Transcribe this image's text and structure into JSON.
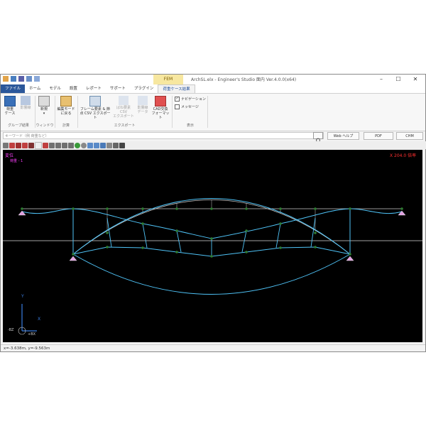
{
  "window": {
    "title": "ArchSL.elx - Engineer's Studio 面内 Ver.4.0.0(x64)",
    "context_tab_group": "FEM",
    "controls": {
      "minimize": "–",
      "maximize": "☐",
      "close": "✕"
    }
  },
  "menu": {
    "items": [
      "ファイル",
      "ホーム",
      "モデル",
      "設置",
      "レポート",
      "サポート",
      "プラグイン",
      "荷重ケース結果"
    ]
  },
  "ribbon": {
    "buttons": [
      {
        "label1": "荷重",
        "label2": "ケース"
      },
      {
        "label1": "影響線",
        "label2": ""
      },
      {
        "label1": "新規",
        "label2": "▾"
      },
      {
        "label1": "編集モード",
        "label2": "に戻る"
      },
      {
        "label1": "フレーム要素 & 節",
        "label2": "点 CSV エクスポート"
      },
      {
        "label1": "ばね要素 CSV",
        "label2": "エクスポート"
      },
      {
        "label1": "影響線",
        "label2": "データ"
      },
      {
        "label1": "CAD交換",
        "label2": "フォーマット"
      }
    ],
    "groups": [
      "グループ結果",
      "ウィンドウ",
      "計算",
      "エクスポート",
      "表示"
    ],
    "checkboxes": [
      {
        "label": "ナビゲーション",
        "checked": true
      },
      {
        "label": "メッセージ",
        "checked": false
      }
    ]
  },
  "search": {
    "placeholder": "キーワード（例 荷重など）",
    "buttons": [
      "Web ヘルプ",
      "PDF",
      "CHM"
    ]
  },
  "viewport": {
    "view_label": "変位",
    "case_label": "荷重 - 1",
    "scale_label": "X 204.0 倍率",
    "axis_y": "Y",
    "axis_x": "X",
    "axis_origin": "-BZ",
    "axis_plus": "+BX",
    "colors": {
      "background": "#000000",
      "deformed": "#4fc3f7",
      "original": "#c8c8c8",
      "node": "#2e7d32",
      "support": "#e0a0e0",
      "label": "#ff40ff",
      "scale": "#ff3030"
    }
  },
  "status": {
    "coordinates": "x=-3.638m, y=-9.563m"
  }
}
